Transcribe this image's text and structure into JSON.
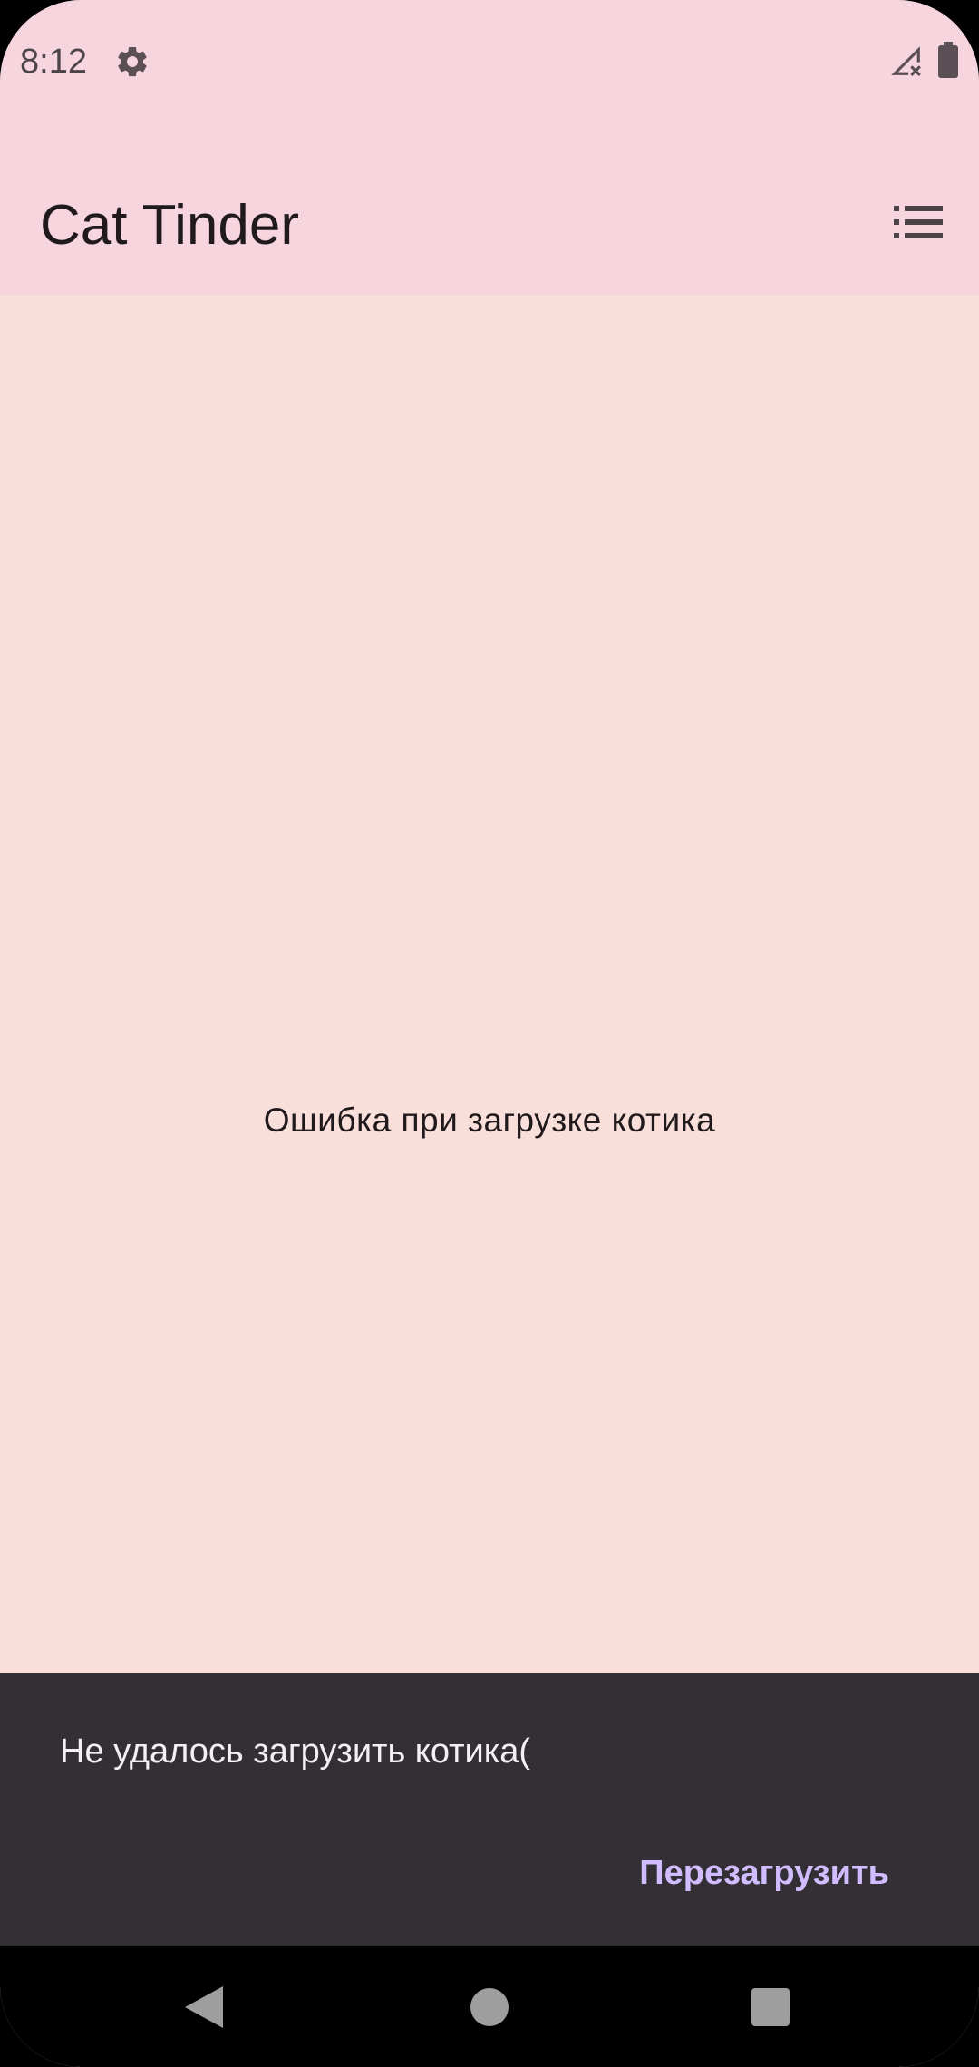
{
  "status_bar": {
    "time": "8:12",
    "settings_icon": "gear-icon",
    "signal_icon": "signal-no-service-icon",
    "battery_icon": "battery-icon"
  },
  "app_bar": {
    "title": "Cat Tinder",
    "list_icon": "list-icon"
  },
  "main": {
    "error_message": "Ошибка при загрузке котика"
  },
  "snackbar": {
    "message": "Не удалось загрузить котика(",
    "action_label": "Перезагрузить"
  },
  "nav_bar": {
    "back_icon": "back-triangle-icon",
    "home_icon": "home-circle-icon",
    "recents_icon": "recents-square-icon"
  },
  "colors": {
    "app_bar_bg": "#f6d5df",
    "content_bg": "#f9dfd9",
    "snackbar_bg": "#322f35",
    "snackbar_action": "#d0bcff",
    "nav_bar_bg": "#000000",
    "nav_icon": "#9e9e9e"
  }
}
